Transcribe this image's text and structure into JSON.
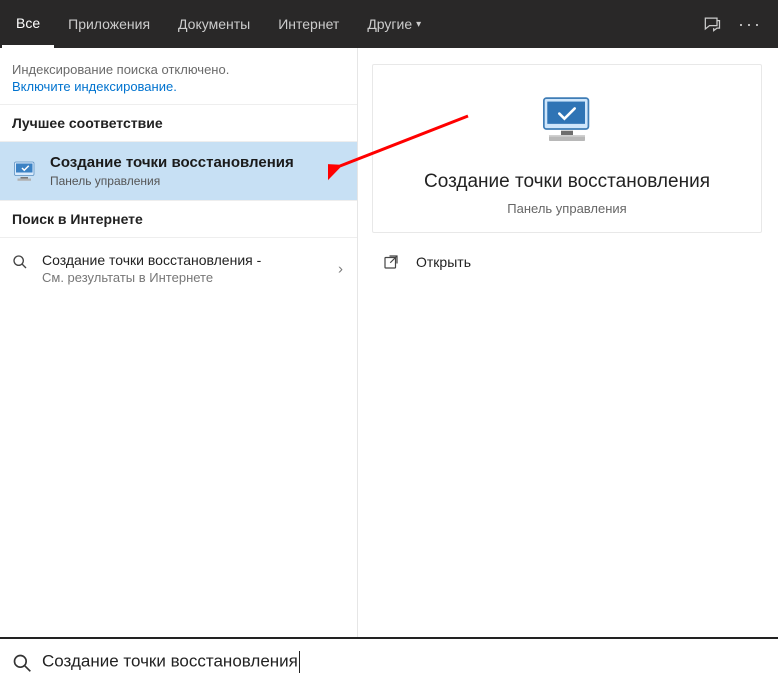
{
  "tabs": {
    "all": "Все",
    "apps": "Приложения",
    "docs": "Документы",
    "web": "Интернет",
    "more": "Другие"
  },
  "indexing": {
    "off": "Индексирование поиска отключено.",
    "enable": "Включите индексирование."
  },
  "sections": {
    "best": "Лучшее соответствие",
    "websearch": "Поиск в Интернете"
  },
  "best": {
    "title": "Создание точки восстановления",
    "sub": "Панель управления"
  },
  "webresult": {
    "line1": "Создание точки восстановления -",
    "line2": "См. результаты в Интернете"
  },
  "detail": {
    "title": "Создание точки восстановления",
    "sub": "Панель управления"
  },
  "actions": {
    "open": "Открыть"
  },
  "search": {
    "query": "Создание точки восстановления"
  }
}
